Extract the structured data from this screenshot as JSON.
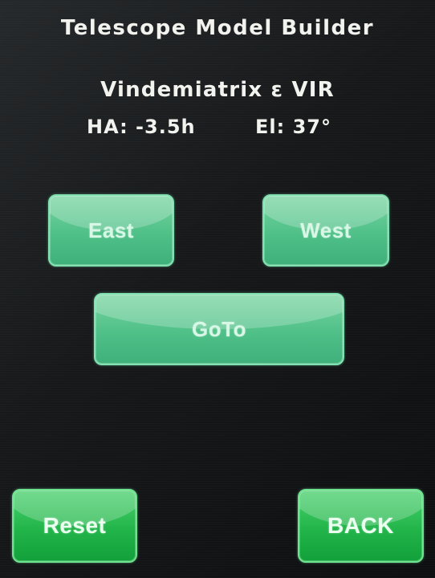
{
  "header": {
    "title": "Telescope Model Builder"
  },
  "target": {
    "name": "Vindemiatrix ε VIR",
    "ha": "HA: -3.5h",
    "el": "El: 37°"
  },
  "buttons": {
    "east": "East",
    "west": "West",
    "goto": "GoTo",
    "reset": "Reset",
    "back": "BACK"
  },
  "colors": {
    "text": "#f2f2ee",
    "button_light": "#4fc088",
    "button_dark": "#22b54a",
    "background": "#16181a"
  }
}
